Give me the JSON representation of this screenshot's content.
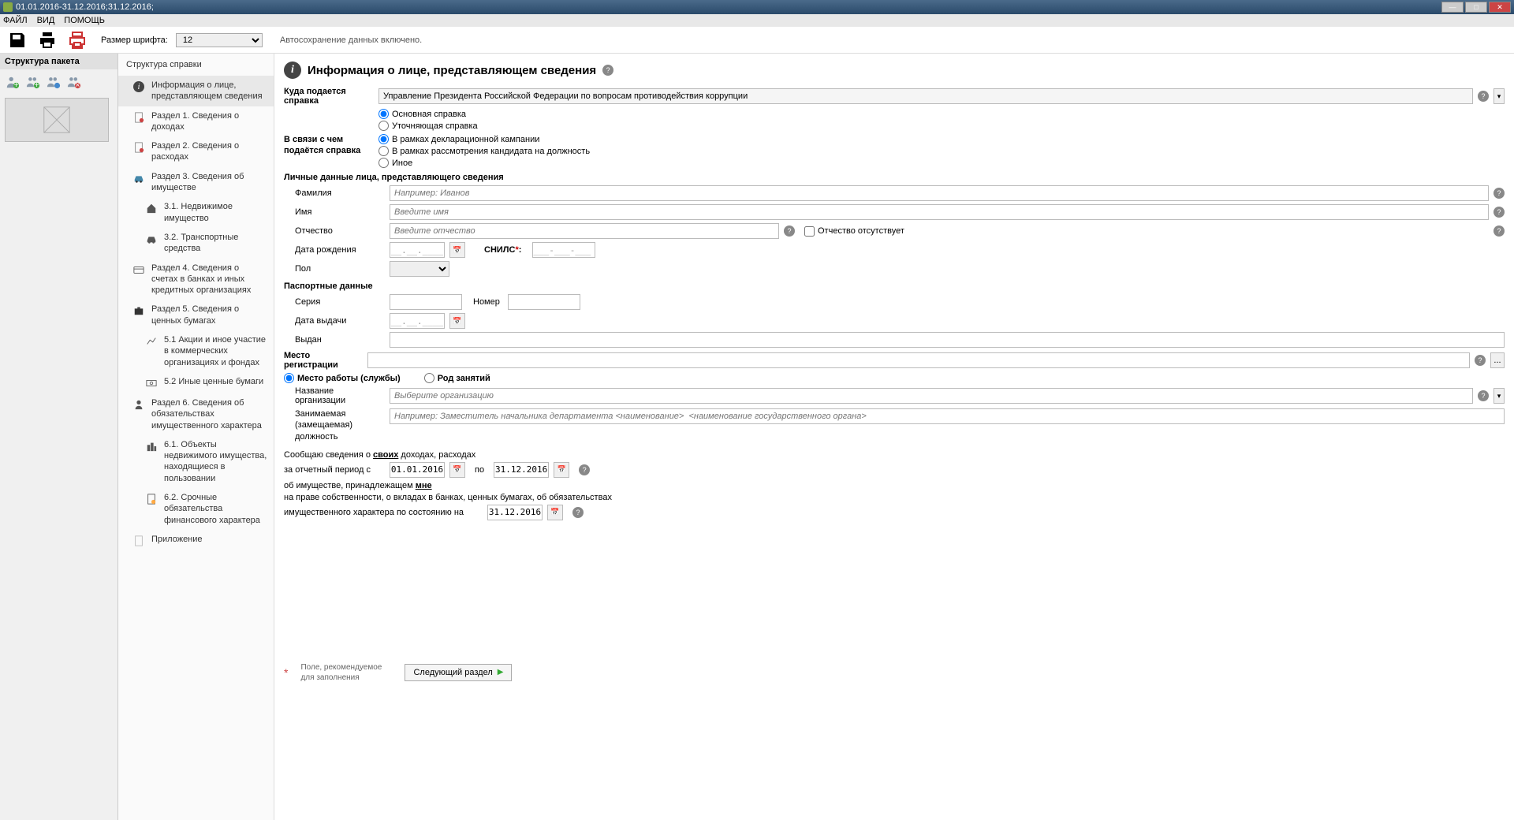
{
  "title": "01.01.2016-31.12.2016;31.12.2016;",
  "menu": {
    "file": "ФАЙЛ",
    "view": "ВИД",
    "help": "ПОМОЩЬ"
  },
  "toolbar": {
    "fontsize_label": "Размер шрифта:",
    "fontsize_value": "12",
    "autosave": "Автосохранение данных включено."
  },
  "left": {
    "header": "Структура пакета"
  },
  "tree": {
    "header": "Структура справки",
    "items": [
      {
        "label": "Информация о лице, представляющем сведения"
      },
      {
        "label": "Раздел 1. Сведения о доходах"
      },
      {
        "label": "Раздел 2. Сведения о расходах"
      },
      {
        "label": "Раздел 3. Сведения об имуществе"
      },
      {
        "label": "3.1. Недвижимое имущество"
      },
      {
        "label": "3.2. Транспортные средства"
      },
      {
        "label": "Раздел 4. Сведения о счетах в банках и иных кредитных организациях"
      },
      {
        "label": "Раздел 5. Сведения о ценных бумагах"
      },
      {
        "label": "5.1 Акции и иное участие в коммерческих организациях и фондах"
      },
      {
        "label": "5.2 Иные ценные бумаги"
      },
      {
        "label": "Раздел 6. Сведения об обязательствах имущественного характера"
      },
      {
        "label": "6.1. Объекты недвижимого имущества, находящиеся в пользовании"
      },
      {
        "label": "6.2. Срочные обязательства финансового характера"
      },
      {
        "label": "Приложение"
      }
    ]
  },
  "section": {
    "title": "Информация о лице, представляющем сведения",
    "where_label": "Куда подается справка",
    "where_value": "Управление Президента Российской Федерации по вопросам противодействия коррупции",
    "type_main": "Основная справка",
    "type_corr": "Уточняющая справка",
    "reason_label": "В связи с чем подаётся справка",
    "reason_campaign": "В рамках декларационной кампании",
    "reason_candidate": "В рамках рассмотрения кандидата на должность",
    "reason_other": "Иное",
    "personal_header": "Личные данные лица, представляющего сведения",
    "surname": "Фамилия",
    "surname_ph": "Например: Иванов",
    "name": "Имя",
    "name_ph": "Введите имя",
    "patronymic": "Отчество",
    "patronymic_ph": "Введите отчество",
    "no_patronymic": "Отчество отсутствует",
    "dob": "Дата рождения",
    "date_mask": "__.__.____",
    "snils": "СНИЛС",
    "snils_mask": "___-___-___ __",
    "gender": "Пол",
    "passport_header": "Паспортные данные",
    "series": "Серия",
    "number": "Номер",
    "issue_date": "Дата выдачи",
    "issued_by": "Выдан",
    "registration": "Место регистрации",
    "workplace": "Место работы (службы)",
    "occupation": "Род занятий",
    "org_name": "Название организации",
    "org_ph": "Выберите организацию",
    "position": "Занимаемая (замещаемая) должность",
    "position_ph": "Например: Заместитель начальника департамента <наименование>  <наименование государственного органа>",
    "declare1a": "Сообщаю сведения о ",
    "declare1b": "своих",
    "declare1c": " доходах, расходах",
    "period_from": "за отчетный период с",
    "period_mid": "по",
    "date_from": "01.01.2016",
    "date_to": "31.12.2016",
    "declare2a": "об имуществе, принадлежащем ",
    "declare2b": "мне",
    "declare3": "на праве собственности, о вкладах в банках, ценных бумагах, об обязательствах",
    "declare4": "имущественного характера по состоянию на",
    "date_asof": "31.12.2016"
  },
  "footer": {
    "note": "Поле, рекомендуемое для заполнения",
    "next": "Следующий раздел"
  }
}
